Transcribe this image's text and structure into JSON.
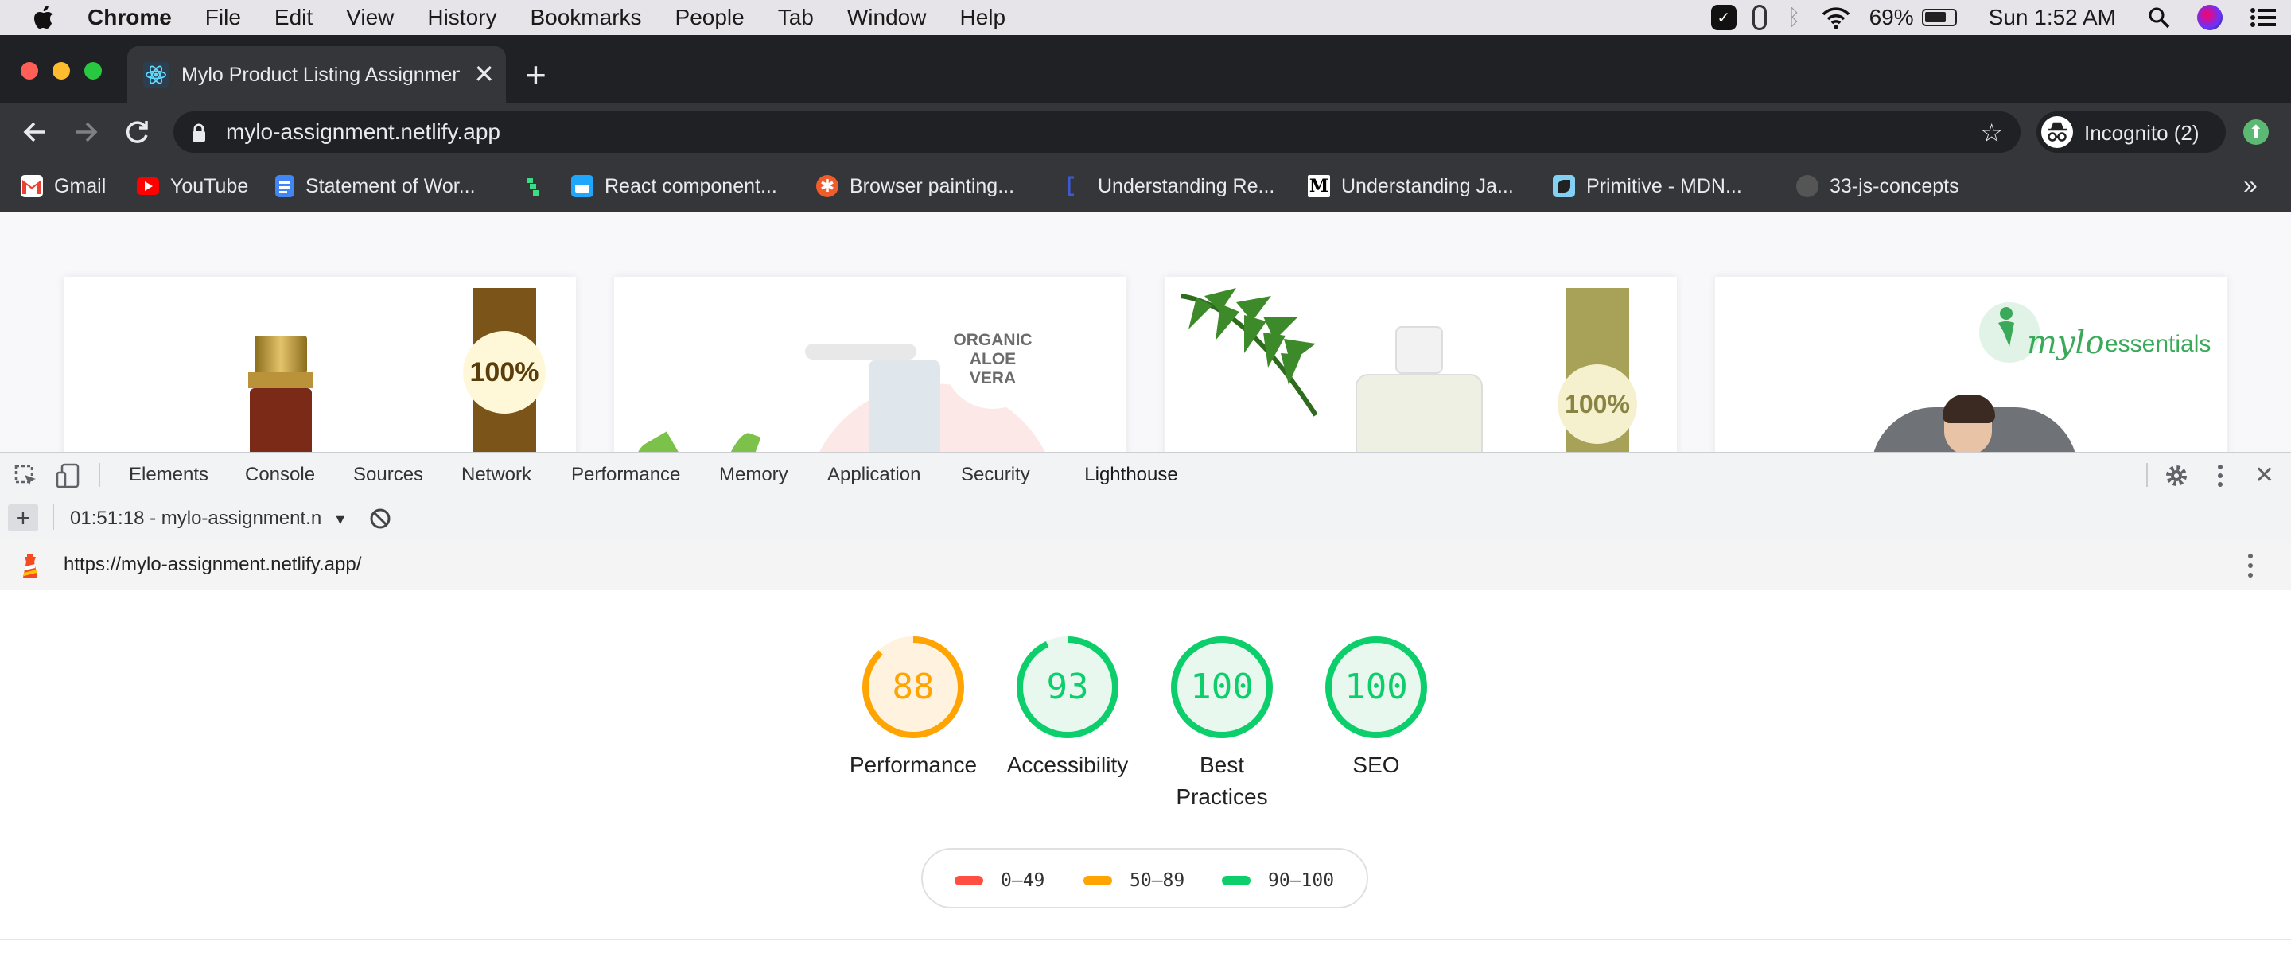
{
  "menubar": {
    "app_name": "Chrome",
    "menus": [
      "File",
      "Edit",
      "View",
      "History",
      "Bookmarks",
      "People",
      "Tab",
      "Window",
      "Help"
    ],
    "battery": "69%",
    "clock": "Sun 1:52 AM"
  },
  "browser": {
    "tab_title": "Mylo Product Listing Assignment",
    "new_tab_label": "+",
    "url": "mylo-assignment.netlify.app",
    "profile_label": "Incognito (2)",
    "bookmarks": [
      {
        "label": "Gmail",
        "icon": "gmail-icon",
        "color": "#ea4335"
      },
      {
        "label": "YouTube",
        "icon": "youtube-icon",
        "color": "#ff0000"
      },
      {
        "label": "Statement of Wor...",
        "icon": "docs-icon",
        "color": "#4285f4"
      },
      {
        "label": "",
        "icon": "green-logo-icon",
        "color": "#3ddc84"
      },
      {
        "label": "React component...",
        "icon": "storybook-icon",
        "color": "#1ea7fd"
      },
      {
        "label": "Browser painting...",
        "icon": "orange-asterisk-icon",
        "color": "#f25c2a"
      },
      {
        "label": "Understanding Re...",
        "icon": "bracket-icon",
        "color": "#3b5bdb"
      },
      {
        "label": "Understanding Ja...",
        "icon": "medium-icon",
        "color": "#ffffff"
      },
      {
        "label": "Primitive - MDN...",
        "icon": "mdn-icon",
        "color": "#83d0f2"
      },
      {
        "label": "33-js-concepts",
        "icon": "github-icon",
        "color": "#555555"
      }
    ],
    "overflow_label": "»"
  },
  "page_preview": {
    "badge_100": "100%",
    "organic_text": "ORGANIC ALOE VERA",
    "mylo_logo": "mylo",
    "essentials": "essentials"
  },
  "devtools": {
    "tabs": [
      "Elements",
      "Console",
      "Sources",
      "Network",
      "Performance",
      "Memory",
      "Application",
      "Security",
      "Lighthouse"
    ],
    "active_tab": "Lighthouse",
    "report_selector": "01:51:18 - mylo-assignment.n",
    "report_url": "https://mylo-assignment.netlify.app/"
  },
  "lighthouse": {
    "scores": [
      {
        "label": "Performance",
        "score": 88,
        "color": "#ffa400",
        "bg": "#fff3e0"
      },
      {
        "label": "Accessibility",
        "score": 93,
        "color": "#0cce6b",
        "bg": "#e8f8ef"
      },
      {
        "label": "Best\nPractices",
        "score": 100,
        "color": "#0cce6b",
        "bg": "#e8f8ef"
      },
      {
        "label": "SEO",
        "score": 100,
        "color": "#0cce6b",
        "bg": "#e8f8ef"
      }
    ],
    "legend": [
      {
        "range": "0–49",
        "color": "#ff4e42"
      },
      {
        "range": "50–89",
        "color": "#ffa400"
      },
      {
        "range": "90–100",
        "color": "#0cce6b"
      }
    ]
  }
}
